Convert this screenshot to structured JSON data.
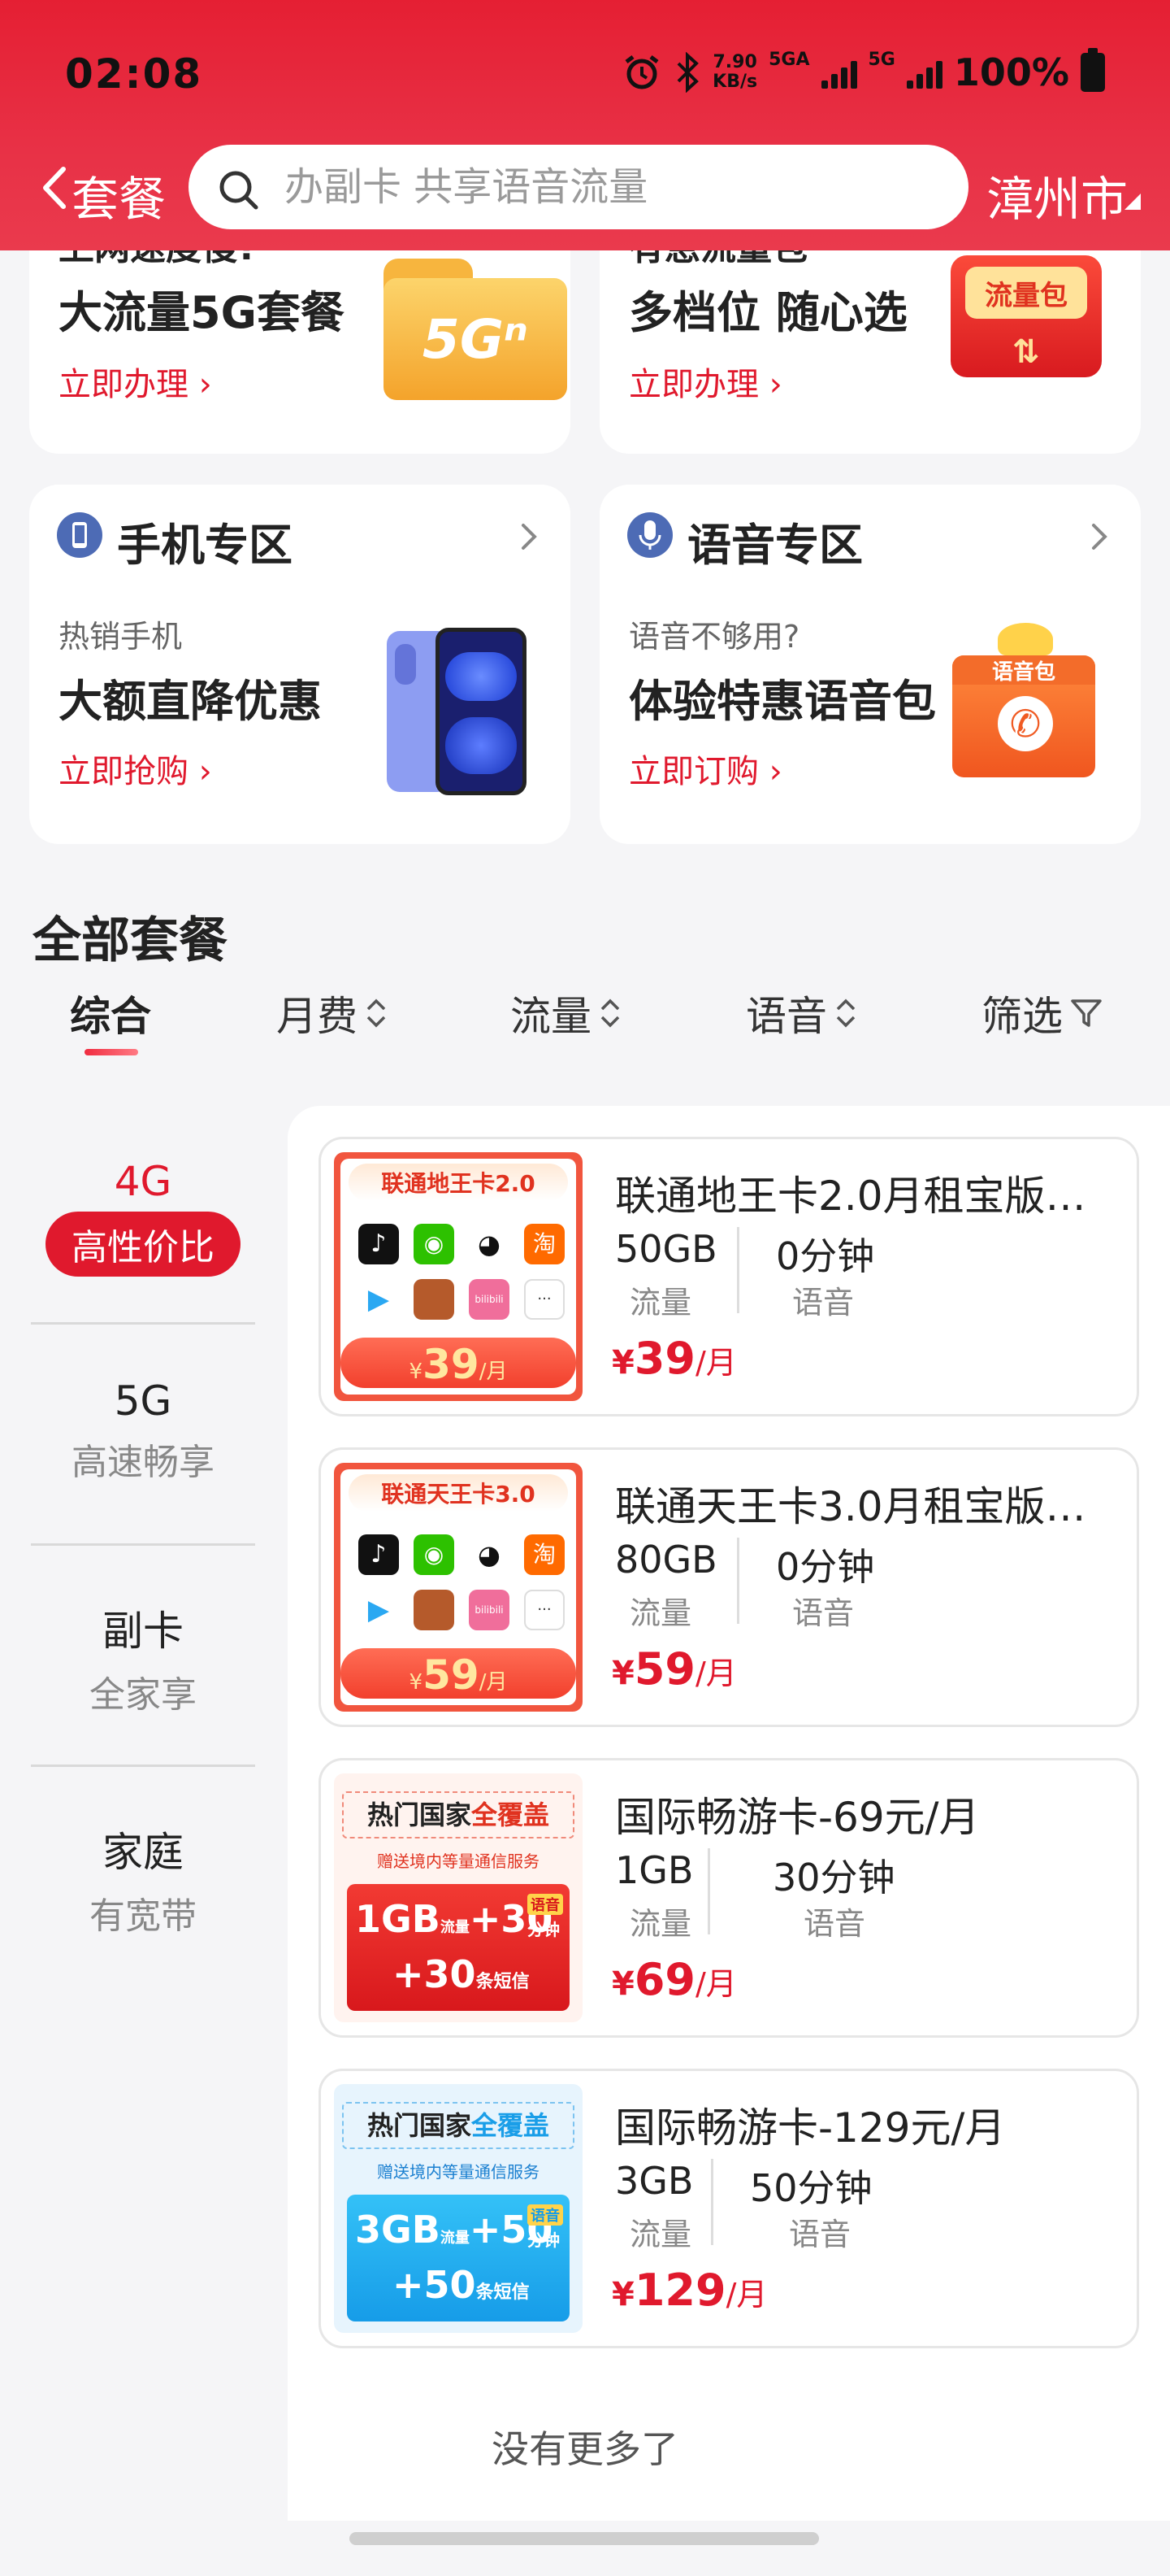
{
  "status_bar": {
    "time": "02:08",
    "net_speed_top": "7.90",
    "net_speed_bottom": "KB/s",
    "sig1": "5GA",
    "sig2": "5G",
    "battery": "100%"
  },
  "nav": {
    "title": "套餐",
    "search_placeholder": "办副卡 共享语音流量",
    "city": "漳州市"
  },
  "promos": [
    {
      "partial_title": "上网速度慢?",
      "main": "大流量5G套餐",
      "cta": "立即办理",
      "art_text": "5Gⁿ"
    },
    {
      "partial_title": "有急流量包",
      "main": "多档位 随心选",
      "cta": "立即办理",
      "art_text": "流量包"
    },
    {
      "title": "手机专区",
      "sub": "热销手机",
      "main": "大额直降优惠",
      "cta": "立即抢购"
    },
    {
      "title": "语音专区",
      "sub": "语音不够用?",
      "main": "体验特惠语音包",
      "cta": "立即订购",
      "art_text": "语音包"
    }
  ],
  "section_title": "全部套餐",
  "filters": [
    "综合",
    "月费",
    "流量",
    "语音",
    "筛选"
  ],
  "categories": [
    {
      "name": "4G",
      "sub": "高性价比"
    },
    {
      "name": "5G",
      "sub": "高速畅享"
    },
    {
      "name": "副卡",
      "sub": "全家享"
    },
    {
      "name": "家庭",
      "sub": "有宽带"
    }
  ],
  "plans": [
    {
      "name": "联通地王卡2.0月租宝版（...",
      "data": "50GB",
      "data_label": "流量",
      "voice": "0分钟",
      "voice_label": "语音",
      "yen": "¥",
      "price": "39",
      "unit": "/月",
      "thumb": {
        "header": "联通地王卡2.0",
        "price": "39",
        "unit": "/月"
      }
    },
    {
      "name": "联通天王卡3.0月租宝版（...",
      "data": "80GB",
      "data_label": "流量",
      "voice": "0分钟",
      "voice_label": "语音",
      "yen": "¥",
      "price": "59",
      "unit": "/月",
      "thumb": {
        "header": "联通天王卡3.0",
        "price": "59",
        "unit": "/月"
      }
    },
    {
      "name": "国际畅游卡-69元/月",
      "data": "1GB",
      "data_label": "流量",
      "voice": "30分钟",
      "voice_label": "语音",
      "yen": "¥",
      "price": "69",
      "unit": "/月",
      "thumb": {
        "header_a": "热门国家",
        "header_b": "全覆盖",
        "sub": "赠送境内等量通信服务",
        "l1a": "1GB",
        "l1b": "流量",
        "l1c": "+30",
        "l1d": "语音",
        "l1e": "分钟",
        "l2a": "+30",
        "l2b": "条短信"
      }
    },
    {
      "name": "国际畅游卡-129元/月",
      "data": "3GB",
      "data_label": "流量",
      "voice": "50分钟",
      "voice_label": "语音",
      "yen": "¥",
      "price": "129",
      "unit": "/月",
      "thumb": {
        "header_a": "热门国家",
        "header_b": "全覆盖",
        "sub": "赠送境内等量通信服务",
        "l1a": "3GB",
        "l1b": "流量",
        "l1c": "+50",
        "l1d": "语音",
        "l1e": "分钟",
        "l2a": "+50",
        "l2b": "条短信"
      }
    }
  ],
  "apps_row1": [
    "抖音",
    "微信",
    "QQ",
    "淘"
  ],
  "apps_row2": [
    "腾讯视频",
    "王者",
    "bilibili",
    "···"
  ],
  "no_more": "没有更多了",
  "colors": {
    "brand_red": "#e0192d",
    "header_red": "#e51f33",
    "ice_blue": "#1a9ee8"
  }
}
